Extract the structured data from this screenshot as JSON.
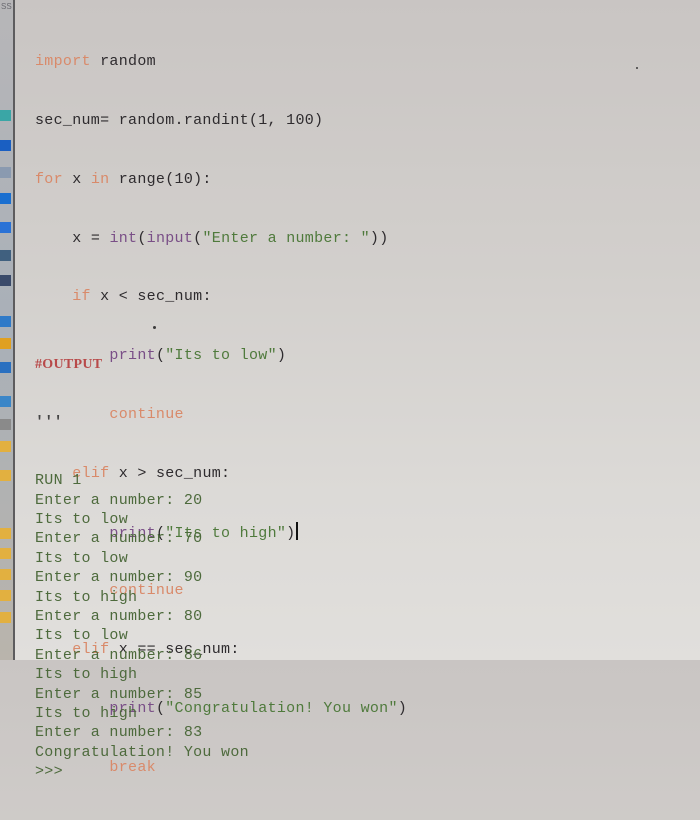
{
  "desktop": {
    "strip_label": "SS",
    "icons": [
      {
        "name": "app-icon-teal",
        "color": "#3aa6a6"
      },
      {
        "name": "app-icon-blue",
        "color": "#1a5fc2"
      },
      {
        "name": "document-icon",
        "color": "#8a9ab0"
      },
      {
        "name": "download-arrow-icon",
        "color": "#1a6fd0"
      },
      {
        "name": "music-note-icon",
        "color": "#2a72d6"
      },
      {
        "name": "picture-icon",
        "color": "#40607f"
      },
      {
        "name": "film-icon",
        "color": "#3a4a6a"
      },
      {
        "name": "grid-app-icon",
        "color": "#2f7ac8"
      },
      {
        "name": "folder-icon",
        "color": "#e0a020"
      },
      {
        "name": "puzzle-icon",
        "color": "#2a70c0"
      },
      {
        "name": "calculator-icon",
        "color": "#3a86c8"
      },
      {
        "name": "trash-icon",
        "color": "#8a8a8a"
      },
      {
        "name": "file-icon-yellow-1",
        "color": "#e2b040"
      },
      {
        "name": "file-icon-yellow-2",
        "color": "#e2b040"
      },
      {
        "name": "file-icon-yellow-3",
        "color": "#e2b040"
      },
      {
        "name": "file-icon-yellow-4",
        "color": "#e2b040"
      },
      {
        "name": "file-icon-yellow-5",
        "color": "#e2b040"
      },
      {
        "name": "file-icon-yellow-6",
        "color": "#e2b040"
      },
      {
        "name": "file-icon-yellow-7",
        "color": "#e2b040"
      }
    ]
  },
  "colors": {
    "keyword": "#d98a6a",
    "builtin": "#7a4f87",
    "string": "#4f7a3c",
    "comment": "#b84a4a",
    "text": "#2e2b2e",
    "output_text": "#4d6a3c"
  },
  "code": {
    "l1": {
      "kw": "import",
      "rest": " random"
    },
    "l2": {
      "text": "sec_num= random.randint(1, 100)"
    },
    "l3": {
      "kw1": "for",
      "mid": " x ",
      "kw2": "in",
      "rest": " range(10):"
    },
    "l4": {
      "indent": "    ",
      "pre": "x = ",
      "bi1": "int",
      "mid": "(",
      "bi2": "input",
      "open": "(",
      "str": "\"Enter a number: \"",
      "close": "))"
    },
    "l5": {
      "indent": "    ",
      "kw": "if",
      "rest": " x < sec_num:"
    },
    "l6": {
      "indent": "        ",
      "bi": "print",
      "open": "(",
      "str": "\"Its to low\"",
      "close": ")"
    },
    "l7": {
      "indent": "        ",
      "kw": "continue"
    },
    "l8": {
      "indent": "    ",
      "kw": "elif",
      "rest": " x > sec_num:"
    },
    "l9": {
      "indent": "        ",
      "bi": "print",
      "open": "(",
      "str": "\"Its to high\"",
      "close": ")"
    },
    "l10": {
      "indent": "        ",
      "kw": "continue"
    },
    "l11": {
      "indent": "    ",
      "kw": "elif",
      "rest": " x == sec_num:"
    },
    "l12": {
      "indent": "        ",
      "bi": "print",
      "open": "(",
      "str": "\"Congratulation! You won\"",
      "close": ")"
    },
    "l13": {
      "indent": "        ",
      "kw": "break"
    }
  },
  "output": {
    "comment": "#OUTPUT",
    "docstring_open": "'''",
    "lines": [
      "RUN 1",
      "Enter a number: 20",
      "Its to low",
      "Enter a number: 70",
      "Its to low",
      "Enter a number: 90",
      "Its to high",
      "Enter a number: 80",
      "Its to low",
      "Enter a number: 86",
      "Its to high",
      "Enter a number: 85",
      "Its to high",
      "Enter a number: 83",
      "Congratulation! You won",
      ">>>"
    ]
  }
}
